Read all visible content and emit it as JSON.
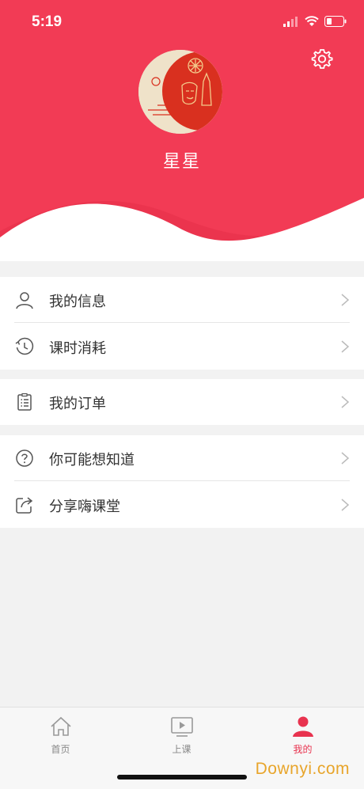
{
  "status_bar": {
    "time": "5:19"
  },
  "profile": {
    "username": "星星"
  },
  "menu_groups": [
    {
      "items": [
        {
          "label": "我的信息",
          "icon": "user-icon"
        },
        {
          "label": "课时消耗",
          "icon": "history-clock-icon"
        }
      ]
    },
    {
      "items": [
        {
          "label": "我的订单",
          "icon": "order-list-icon"
        }
      ]
    },
    {
      "items": [
        {
          "label": "你可能想知道",
          "icon": "question-icon"
        },
        {
          "label": "分享嗨课堂",
          "icon": "share-icon"
        }
      ]
    }
  ],
  "tabbar": {
    "home": "首页",
    "class": "上课",
    "mine": "我的"
  },
  "colors": {
    "accent": "#f23b55",
    "active_tab": "#e8334f"
  },
  "watermark": "Downyi.com"
}
